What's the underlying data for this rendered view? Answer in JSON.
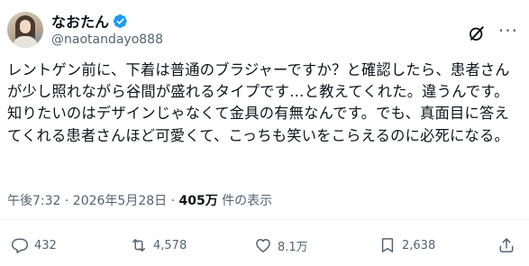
{
  "user": {
    "display_name": "なおたん",
    "handle": "@naotandayo888"
  },
  "post": {
    "text": "レントゲン前に、下着は普通のブラジャーですか？と確認したら、患者さんが少し照れながら谷間が盛れるタイプです…と教えてくれた。違うんです。知りたいのはデザインじゃなくて金具の有無なんです。でも、真面目に答えてくれる患者さんほど可愛くて、こっちも笑いをこらえるのに必死になる。",
    "time": "午後7:32 · 2026年5月28日 · ",
    "views": "405万",
    "views_suffix": " 件の表示"
  },
  "actions": {
    "replies": "432",
    "reposts": "4,578",
    "likes": "8.1万",
    "bookmarks": "2,638"
  },
  "colors": {
    "verified": "#1d9bf0",
    "muted": "#536471",
    "text": "#0f1419"
  },
  "icons": [
    "verified-badge-icon",
    "grok-icon",
    "more-icon",
    "reply-icon",
    "repost-icon",
    "like-icon",
    "bookmark-icon",
    "share-icon"
  ]
}
